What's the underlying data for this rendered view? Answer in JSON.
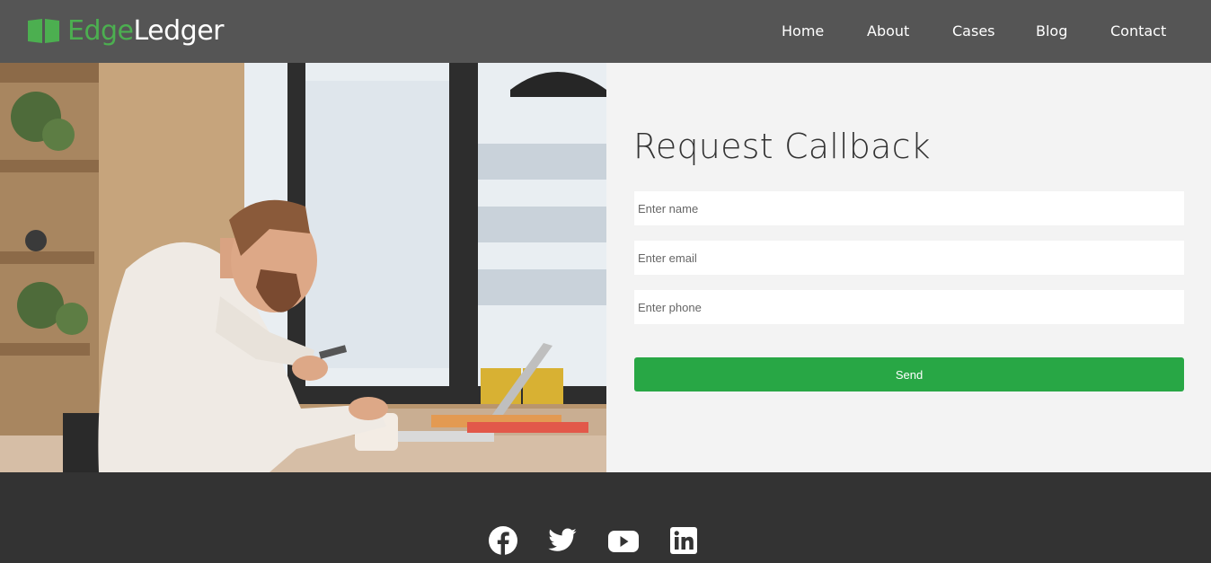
{
  "brand": {
    "name_part1": "Edge",
    "name_part2": "Ledger",
    "icon": "book-icon",
    "accent_color": "#4caf50"
  },
  "nav": {
    "items": [
      {
        "label": "Home"
      },
      {
        "label": "About"
      },
      {
        "label": "Cases"
      },
      {
        "label": "Blog"
      },
      {
        "label": "Contact"
      }
    ]
  },
  "hero": {
    "image": "man-with-phone-and-laptop-photo"
  },
  "form": {
    "title": "Request Callback",
    "name_placeholder": "Enter name",
    "email_placeholder": "Enter email",
    "phone_placeholder": "Enter phone",
    "submit_label": "Send",
    "button_color": "#28a745"
  },
  "footer": {
    "social": [
      "facebook-icon",
      "twitter-icon",
      "youtube-icon",
      "linkedin-icon"
    ]
  },
  "colors": {
    "navbar": "#555555",
    "footer": "#333333",
    "form_panel": "#f3f3f3"
  }
}
